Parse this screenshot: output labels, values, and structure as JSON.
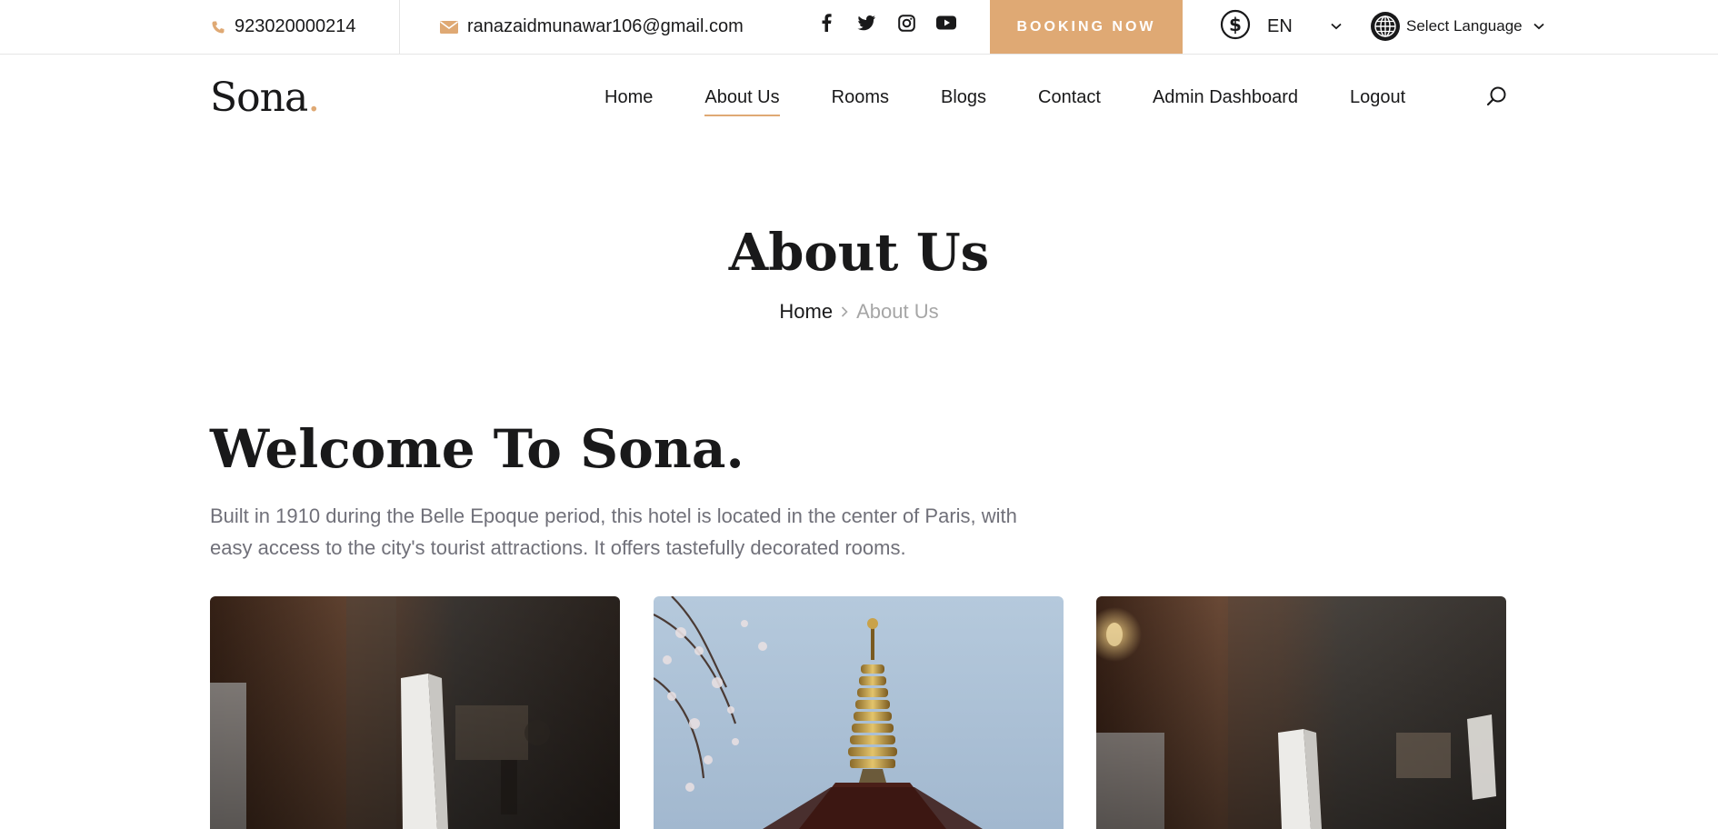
{
  "topbar": {
    "phone": "923020000214",
    "email": "ranazaidmunawar106@gmail.com",
    "socials": [
      "facebook-icon",
      "twitter-icon",
      "instagram-icon",
      "youtube-icon"
    ],
    "booking_label": "BOOKING NOW",
    "currency_label": "EN",
    "language_label": "Select Language"
  },
  "brand": {
    "name": "Sona",
    "dot": ".",
    "accent_color": "#dfa974"
  },
  "nav": {
    "items": [
      "Home",
      "About Us",
      "Rooms",
      "Blogs",
      "Contact",
      "Admin Dashboard",
      "Logout"
    ],
    "active": "About Us"
  },
  "hero": {
    "title": "About Us",
    "breadcrumb_home": "Home",
    "breadcrumb_current": "About Us"
  },
  "welcome": {
    "title": "Welcome To Sona.",
    "text": "Built in 1910 during the Belle Epoque period, this hotel is located in the center of Paris, with easy access to the city's tourist attractions. It offers tastefully decorated rooms."
  },
  "gallery": [
    "restaurant-photo",
    "pagoda-photo",
    "restaurant-photo"
  ]
}
